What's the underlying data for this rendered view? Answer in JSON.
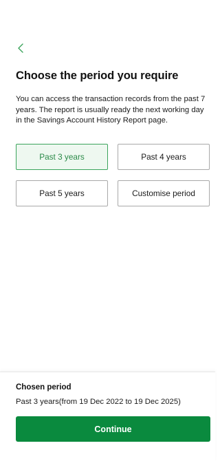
{
  "header": {
    "back_icon": "chevron-left-icon",
    "accent_color": "#2a8a48"
  },
  "main": {
    "title": "Choose the period you require",
    "description": "You can access the transaction records from the past 7 years. The report is usually ready the next working day in the Savings Account History Report page.",
    "options": [
      {
        "label": "Past 3 years",
        "selected": true
      },
      {
        "label": "Past 4 years",
        "selected": false
      },
      {
        "label": "Past 5 years",
        "selected": false
      },
      {
        "label": "Customise period",
        "selected": false
      }
    ]
  },
  "footer": {
    "chosen_label": "Chosen period",
    "chosen_value": "Past 3 years(from 19 Dec 2022 to 19 Dec 2025)",
    "continue_label": "Continue",
    "button_color": "#0a8a3e"
  }
}
